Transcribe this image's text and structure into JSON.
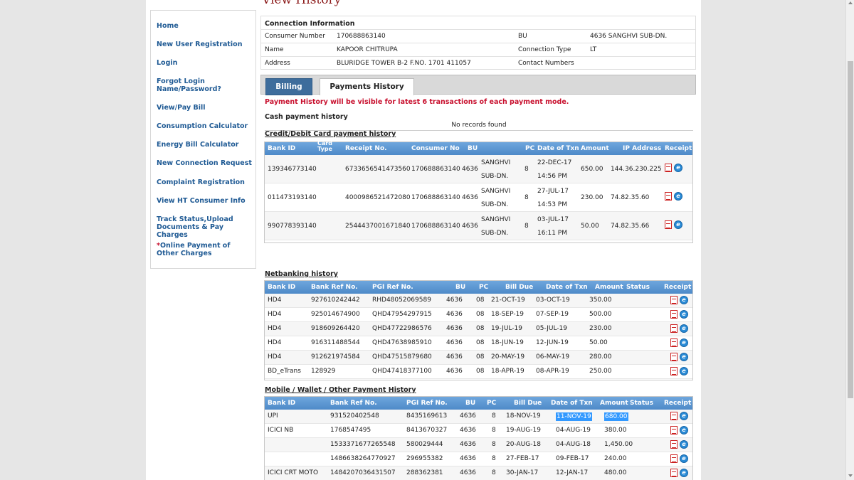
{
  "page_title": "View History",
  "nav": [
    {
      "label": "Home",
      "red": ""
    },
    {
      "label": "New User Registration",
      "red": ""
    },
    {
      "label": "Login",
      "red": ""
    },
    {
      "label": "Forgot Login Name/Password?",
      "red": ""
    },
    {
      "label": "View/Pay Bill",
      "red": ""
    },
    {
      "label": "Consumption Calculator",
      "red": ""
    },
    {
      "label": "Energy Bill Calculator",
      "red": ""
    },
    {
      "label": "New Connection Request",
      "red": ""
    },
    {
      "label": "Complaint Registration",
      "red": ""
    },
    {
      "label": "View HT Consumer Info",
      "red": ""
    },
    {
      "label": "Track Status,Upload Documents & Pay Charges",
      "red": ""
    },
    {
      "label": "Online Payment of Other Charges",
      "red": "*"
    }
  ],
  "connection": {
    "heading": "Connection Information",
    "consumer_number_label": "Consumer Number",
    "consumer_number": "170688863140",
    "bu_label": "BU",
    "bu": "4636 SANGHVI SUB-DN.",
    "name_label": "Name",
    "name": "KAPOOR CHITRUPA",
    "conn_type_label": "Connection Type",
    "conn_type": "LT",
    "address_label": "Address",
    "address": "BLURIDGE TOWER B-2 F.NO. 1701 411057",
    "contact_label": "Contact Numbers",
    "contact": ""
  },
  "tabs": {
    "billing": "Billing",
    "payments": "Payments History"
  },
  "notice": "Payment History will be visible for latest 6 transactions of each payment mode.",
  "cash": {
    "heading": "Cash payment history",
    "empty": "No records found"
  },
  "card": {
    "heading": "Credit/Debit Card payment history",
    "columns": [
      "Bank ID",
      "Card Type",
      "Receipt No.",
      "Consumer No",
      "BU",
      "PC",
      "Date of Txn",
      "Amount",
      "IP Address",
      "Receipt"
    ],
    "rows": [
      {
        "bank_id": "139346773140",
        "receipt_no": "6733656541473560",
        "consumer_no": "170688863140",
        "bu": "4636",
        "bu_name1": "SANGHVI",
        "bu_name2": "SUB-DN.",
        "pc": "8",
        "date": "22-DEC-17",
        "time": "14:56 PM",
        "amount": "650.00",
        "ip": "144.36.230.225"
      },
      {
        "bank_id": "011473193140",
        "receipt_no": "4000986521472080",
        "consumer_no": "170688863140",
        "bu": "4636",
        "bu_name1": "SANGHVI",
        "bu_name2": "SUB-DN.",
        "pc": "8",
        "date": "27-JUL-17",
        "time": "14:53 PM",
        "amount": "230.00",
        "ip": "74.82.35.60"
      },
      {
        "bank_id": "990778393140",
        "receipt_no": "2544437001671840",
        "consumer_no": "170688863140",
        "bu": "4636",
        "bu_name1": "SANGHVI",
        "bu_name2": "SUB-DN.",
        "pc": "8",
        "date": "03-JUL-17",
        "time": "16:11 PM",
        "amount": "50.00",
        "ip": "74.82.35.66"
      }
    ]
  },
  "net": {
    "heading": "Netbanking history",
    "columns": [
      "Bank ID",
      "Bank Ref No.",
      "PGI Ref No.",
      "BU",
      "PC",
      "Bill Due",
      "Date of Txn",
      "Amount",
      "Status",
      "Receipt"
    ],
    "rows": [
      {
        "bank_id": "HD4",
        "bank_ref": "927610242442",
        "pgi_ref": "RHD48052069589",
        "bu": "4636",
        "pc": "08",
        "bill_due": "21-OCT-19",
        "date": "03-OCT-19",
        "amount": "350.00",
        "status": ""
      },
      {
        "bank_id": "HD4",
        "bank_ref": "925014674900",
        "pgi_ref": "QHD47954297915",
        "bu": "4636",
        "pc": "08",
        "bill_due": "18-SEP-19",
        "date": "07-SEP-19",
        "amount": "500.00",
        "status": ""
      },
      {
        "bank_id": "HD4",
        "bank_ref": "918609264420",
        "pgi_ref": "QHD47722986576",
        "bu": "4636",
        "pc": "08",
        "bill_due": "19-JUL-19",
        "date": "05-JUL-19",
        "amount": "230.00",
        "status": ""
      },
      {
        "bank_id": "HD4",
        "bank_ref": "916311488544",
        "pgi_ref": "QHD47638985910",
        "bu": "4636",
        "pc": "08",
        "bill_due": "18-JUN-19",
        "date": "12-JUN-19",
        "amount": "50.00",
        "status": ""
      },
      {
        "bank_id": "HD4",
        "bank_ref": "912621974584",
        "pgi_ref": "QHD47515879680",
        "bu": "4636",
        "pc": "08",
        "bill_due": "20-MAY-19",
        "date": "06-MAY-19",
        "amount": "280.00",
        "status": ""
      },
      {
        "bank_id": "BD_eTrans",
        "bank_ref": "128929",
        "pgi_ref": "QHD47418377100",
        "bu": "4636",
        "pc": "08",
        "bill_due": "18-APR-19",
        "date": "08-APR-19",
        "amount": "250.00",
        "status": ""
      }
    ]
  },
  "mobile": {
    "heading": "Mobile / Wallet / Other Payment History",
    "columns": [
      "Bank ID",
      "Bank Ref No.",
      "PGI Ref No.",
      "BU",
      "PC",
      "Bill Due",
      "Date of Txn",
      "Amount",
      "Status",
      "Receipt"
    ],
    "rows": [
      {
        "bank_id": "UPI",
        "bank_ref": "931520402548",
        "pgi_ref": "8435169613",
        "bu": "4636",
        "pc": "8",
        "bill_due": "18-NOV-19",
        "date": "11-NOV-19",
        "amount": "680.00",
        "status": ""
      },
      {
        "bank_id": "ICICI NB",
        "bank_ref": "1768547495",
        "pgi_ref": "8413670327",
        "bu": "4636",
        "pc": "8",
        "bill_due": "19-AUG-19",
        "date": "04-AUG-19",
        "amount": "380.00",
        "status": ""
      },
      {
        "bank_id": "",
        "bank_ref": "1533371677265548",
        "pgi_ref": "580029444",
        "bu": "4636",
        "pc": "8",
        "bill_due": "20-AUG-18",
        "date": "04-AUG-18",
        "amount": "1,450.00",
        "status": ""
      },
      {
        "bank_id": "",
        "bank_ref": "1486638264770927",
        "pgi_ref": "296955382",
        "bu": "4636",
        "pc": "8",
        "bill_due": "27-FEB-17",
        "date": "09-FEB-17",
        "amount": "240.00",
        "status": ""
      },
      {
        "bank_id": "ICICI CRT MOTO",
        "bank_ref": "1484207036431507",
        "pgi_ref": "288362381",
        "bu": "4636",
        "pc": "8",
        "bill_due": "30-JAN-17",
        "date": "12-JAN-17",
        "amount": "480.00",
        "status": ""
      }
    ]
  },
  "icons": {
    "pdf": "pdf-icon",
    "ie": "browser-icon"
  }
}
